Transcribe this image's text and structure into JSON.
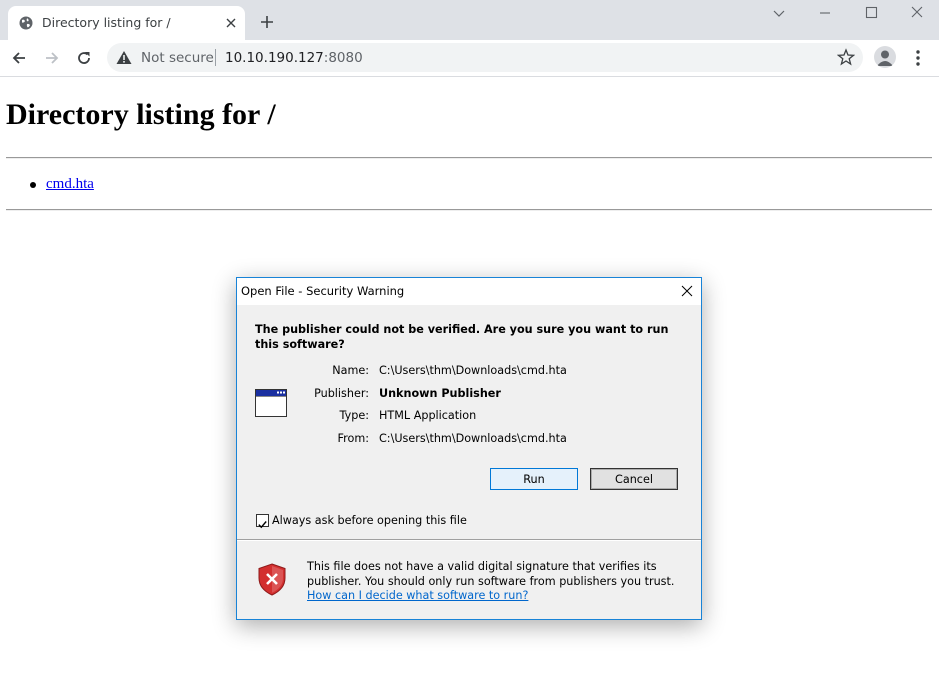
{
  "browser": {
    "tab_title": "Directory listing for /",
    "security_label": "Not secure",
    "url_host": "10.10.190.127",
    "url_port": ":8080"
  },
  "page": {
    "title": "Directory listing for /",
    "items": [
      {
        "label": "cmd.hta"
      }
    ]
  },
  "dialog": {
    "title": "Open File - Security Warning",
    "question": "The publisher could not be verified.  Are you sure you want to run this software?",
    "fields": [
      {
        "label": "Name:",
        "value": "C:\\Users\\thm\\Downloads\\cmd.hta"
      },
      {
        "label": "Publisher:",
        "value": "Unknown Publisher"
      },
      {
        "label": "Type:",
        "value": "HTML Application"
      },
      {
        "label": "From:",
        "value": "C:\\Users\\thm\\Downloads\\cmd.hta"
      }
    ],
    "run_label": "Run",
    "cancel_label": "Cancel",
    "checkbox_label": "Always ask before opening this file",
    "checkbox_checked": true,
    "warning_text": "This file does not have a valid digital signature that verifies its publisher.  You should only run software from publishers you trust.",
    "help_link": "How can I decide what software to run?"
  },
  "colors": {
    "link": "#0000ee",
    "dialog_border": "#1883d7",
    "run_button_border": "#0078d7",
    "shield_red": "#d32f2f"
  }
}
